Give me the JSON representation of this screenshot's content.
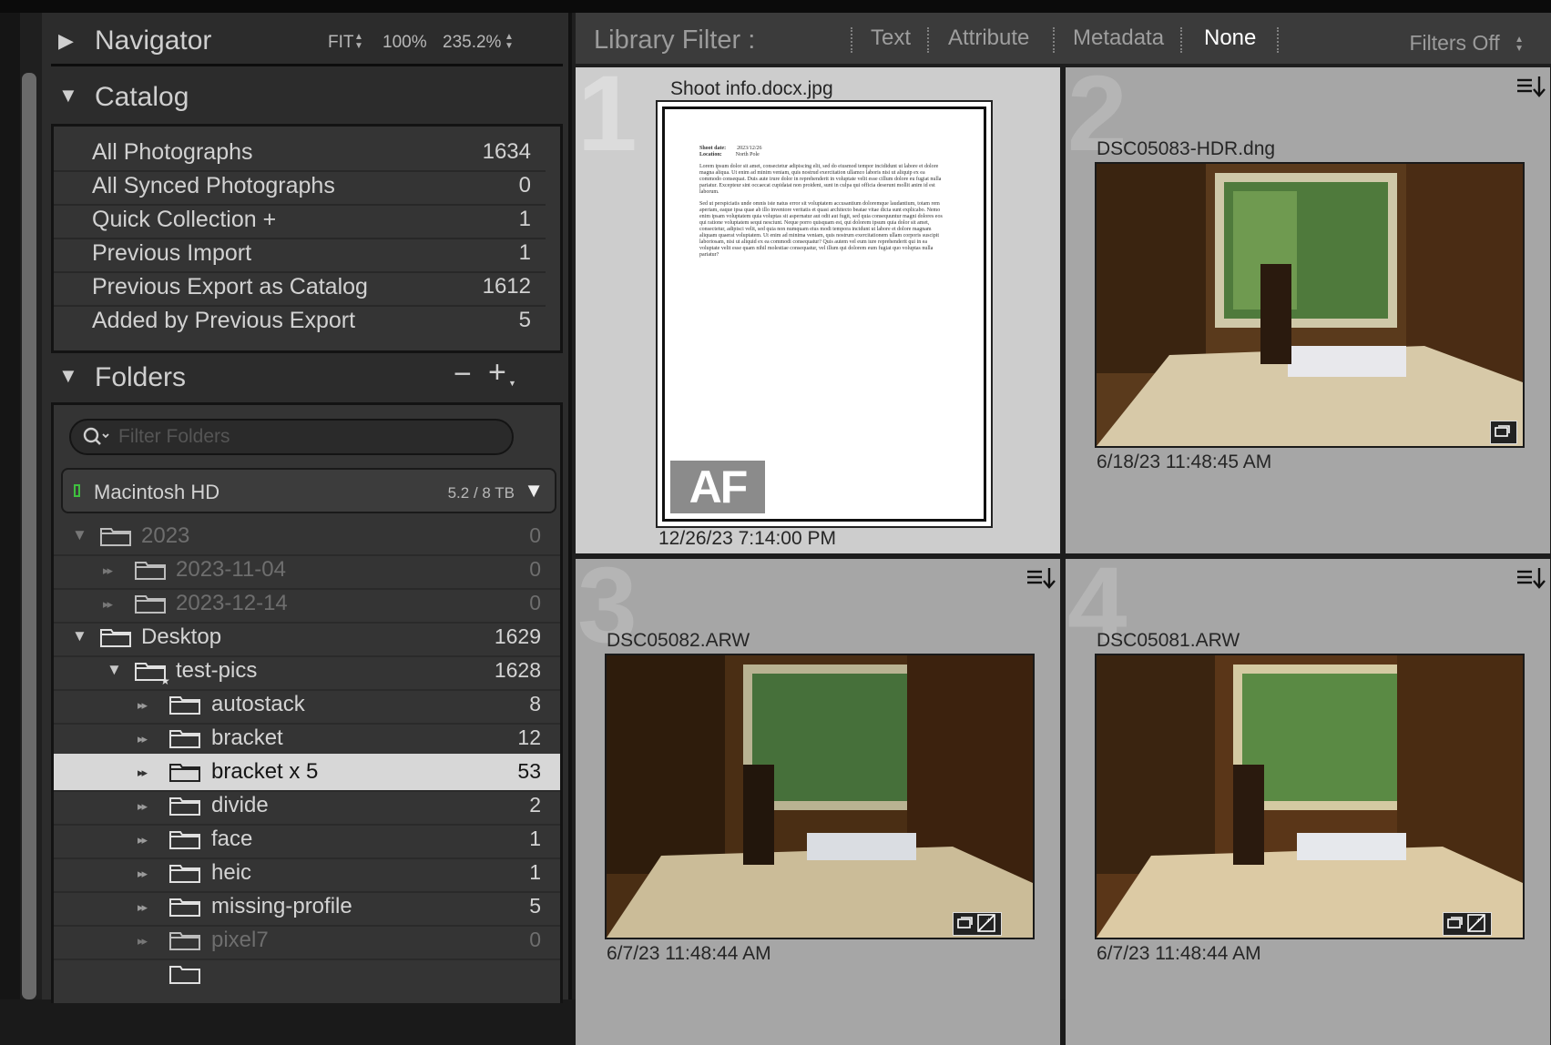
{
  "navigator": {
    "title": "Navigator",
    "zoom": [
      "FIT",
      "100%",
      "235.2%"
    ]
  },
  "catalog": {
    "title": "Catalog",
    "items": [
      {
        "label": "All Photographs",
        "count": "1634"
      },
      {
        "label": "All Synced Photographs",
        "count": "0"
      },
      {
        "label": "Quick Collection +",
        "count": "1"
      },
      {
        "label": "Previous Import",
        "count": "1"
      },
      {
        "label": "Previous Export as Catalog",
        "count": "1612"
      },
      {
        "label": "Added by Previous Export",
        "count": "5"
      }
    ]
  },
  "folders": {
    "title": "Folders",
    "minus": "−",
    "plus": "+",
    "filter_placeholder": "Filter Folders",
    "volume": {
      "name": "Macintosh HD",
      "size": "5.2 / 8 TB"
    },
    "items": [
      {
        "name": "2023",
        "count": "0"
      },
      {
        "name": "2023-11-04",
        "count": "0"
      },
      {
        "name": "2023-12-14",
        "count": "0"
      },
      {
        "name": "Desktop",
        "count": "1629"
      },
      {
        "name": "test-pics",
        "count": "1628"
      },
      {
        "name": "autostack",
        "count": "8"
      },
      {
        "name": "bracket",
        "count": "12"
      },
      {
        "name": "bracket x 5",
        "count": "53"
      },
      {
        "name": "divide",
        "count": "2"
      },
      {
        "name": "face",
        "count": "1"
      },
      {
        "name": "heic",
        "count": "1"
      },
      {
        "name": "missing-profile",
        "count": "5"
      },
      {
        "name": "pixel7",
        "count": "0"
      }
    ]
  },
  "library_filter": {
    "title": "Library Filter :",
    "options": [
      "Text",
      "Attribute",
      "Metadata",
      "None"
    ],
    "active": "None",
    "filters_off": "Filters Off"
  },
  "grid": {
    "cells": [
      {
        "index": "1",
        "filename": "Shoot info.docx.jpg",
        "date": "12/26/23 7:14:00 PM"
      },
      {
        "index": "2",
        "filename": "DSC05083-HDR.dng",
        "date": "6/18/23 11:48:45 AM"
      },
      {
        "index": "3",
        "filename": "DSC05082.ARW",
        "date": "6/7/23 11:48:44 AM"
      },
      {
        "index": "4",
        "filename": "DSC05081.ARW",
        "date": "6/7/23 11:48:44 AM"
      }
    ],
    "doc": {
      "shoot_date_label": "Shoot date:",
      "shoot_date": "2023/12/26",
      "location_label": "Location:",
      "location": "North Pole",
      "para1": "Lorem ipsum dolor sit amet, consectetur adipiscing elit, sed do eiusmod tempor incididunt ut labore et dolore magna aliqua. Ut enim ad minim veniam, quis nostrud exercitation ullamco laboris nisi ut aliquip ex ea commodo consequat. Duis aute irure dolor in reprehenderit in voluptate velit esse cillum dolore eu fugiat nulla pariatur. Excepteur sint occaecat cupidatat non proident, sunt in culpa qui officia deserunt mollit anim id est laborum.",
      "para2": "Sed ut perspiciatis unde omnis iste natus error sit voluptatem accusantium doloremque laudantium, totam rem aperiam, eaque ipsa quae ab illo inventore veritatis et quasi architecto beatae vitae dicta sunt explicabo. Nemo enim ipsam voluptatem quia voluptas sit aspernatur aut odit aut fugit, sed quia consequuntur magni dolores eos qui ratione voluptatem sequi nesciunt. Neque porro quisquam est, qui dolorem ipsum quia dolor sit amet, consectetur, adipisci velit, sed quia non numquam eius modi tempora incidunt ut labore et dolore magnam aliquam quaerat voluptatem. Ut enim ad minima veniam, quis nostrum exercitationem ullam corporis suscipit laboriosam, nisi ut aliquid ex ea commodi consequatur? Quis autem vel eum iure reprehenderit qui in ea voluptate velit esse quam nihil molestiae consequatur, vel illum qui dolorem eum fugiat quo voluptas nulla pariatur?",
      "logo": "AF"
    }
  },
  "colors": {
    "panel_bg": "#2c2c2c",
    "selected_row": "#d7d7d7",
    "grid_cell": "#a6a6a6",
    "grid_cell_selected": "#cdcdcd",
    "volume_indicator": "#3fbf3f"
  },
  "icons": [
    "triangle-right-icon",
    "triangle-down-icon",
    "search-icon",
    "folder-icon",
    "new-folder-icon",
    "sort-menu-icon",
    "badge-stack-icon",
    "badge-edit-icon"
  ]
}
